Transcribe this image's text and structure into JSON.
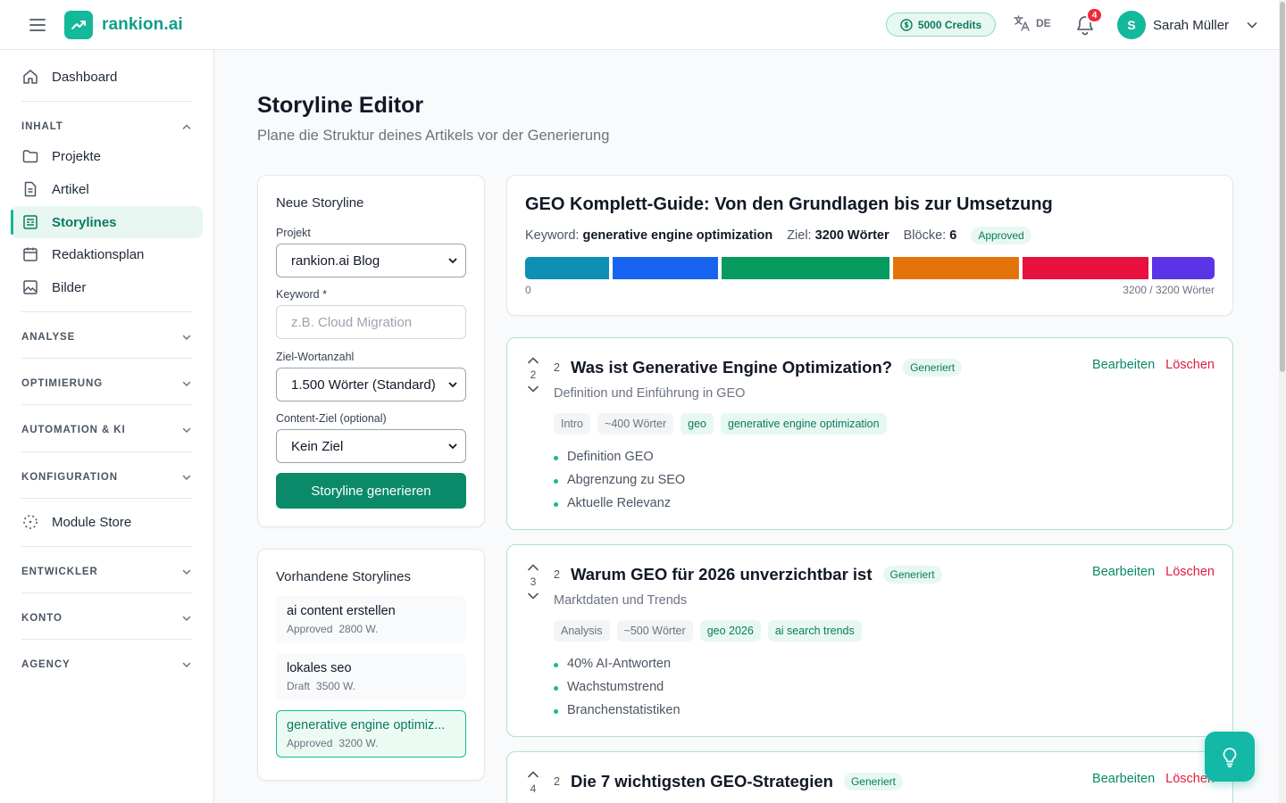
{
  "header": {
    "brand": "rankion.ai",
    "credits": "5000 Credits",
    "language": "DE",
    "notifications_count": "4",
    "user_initial": "S",
    "user_name": "Sarah Müller"
  },
  "sidebar": {
    "dashboard": "Dashboard",
    "sections": {
      "inhalt": "INHALT",
      "analyse": "ANALYSE",
      "optimierung": "OPTIMIERUNG",
      "automation": "AUTOMATION & KI",
      "konfiguration": "KONFIGURATION",
      "entwickler": "ENTWICKLER",
      "konto": "KONTO",
      "agency": "AGENCY"
    },
    "items": {
      "projekte": "Projekte",
      "artikel": "Artikel",
      "storylines": "Storylines",
      "redaktionsplan": "Redaktionsplan",
      "bilder": "Bilder",
      "module_store": "Module Store"
    }
  },
  "page": {
    "title": "Storyline Editor",
    "subtitle": "Plane die Struktur deines Artikels vor der Generierung"
  },
  "new_storyline": {
    "title": "Neue Storyline",
    "project_label": "Projekt",
    "project_value": "rankion.ai Blog",
    "keyword_label": "Keyword *",
    "keyword_placeholder": "z.B. Cloud Migration",
    "target_label": "Ziel-Wortanzahl",
    "target_value": "1.500 Wörter (Standard)",
    "goal_label": "Content-Ziel (optional)",
    "goal_value": "Kein Ziel",
    "button": "Storyline generieren"
  },
  "existing": {
    "title": "Vorhandene Storylines",
    "items": [
      {
        "name": "ai content erstellen",
        "status": "Approved",
        "words": "2800 W."
      },
      {
        "name": "lokales seo",
        "status": "Draft",
        "words": "3500 W."
      },
      {
        "name": "generative engine optimiz...",
        "status": "Approved",
        "words": "3200 W."
      }
    ]
  },
  "overview": {
    "title": "GEO Komplett-Guide: Von den Grundlagen bis zur Umsetzung",
    "keyword_label": "Keyword:",
    "keyword": "generative engine optimization",
    "target_label": "Ziel:",
    "target": "3200 Wörter",
    "blocks_label": "Blöcke:",
    "blocks": "6",
    "status": "Approved",
    "bar_start": "0",
    "bar_total": "3200 / 3200 Wörter",
    "segments": [
      {
        "words": 400,
        "color": "#0e8fb3"
      },
      {
        "words": 500,
        "color": "#1664f0"
      },
      {
        "words": 800,
        "color": "#069a5e"
      },
      {
        "words": 600,
        "color": "#e4740a"
      },
      {
        "words": 600,
        "color": "#e8103f"
      },
      {
        "words": 300,
        "color": "#5b34e8"
      }
    ]
  },
  "blocks": [
    {
      "order": "2",
      "index": "2",
      "title": "Was ist Generative Engine Optimization?",
      "status": "Generiert",
      "subtitle": "Definition und Einführung in GEO",
      "chips": [
        {
          "text": "Intro",
          "style": "gray"
        },
        {
          "text": "~400 Wörter",
          "style": "gray"
        },
        {
          "text": "geo",
          "style": "green"
        },
        {
          "text": "generative engine optimization",
          "style": "green"
        }
      ],
      "bullets": [
        "Definition GEO",
        "Abgrenzung zu SEO",
        "Aktuelle Relevanz"
      ]
    },
    {
      "order": "3",
      "index": "2",
      "title": "Warum GEO für 2026 unverzichtbar ist",
      "status": "Generiert",
      "subtitle": "Marktdaten und Trends",
      "chips": [
        {
          "text": "Analysis",
          "style": "gray"
        },
        {
          "text": "~500 Wörter",
          "style": "gray"
        },
        {
          "text": "geo 2026",
          "style": "green"
        },
        {
          "text": "ai search trends",
          "style": "green"
        }
      ],
      "bullets": [
        "40% AI-Antworten",
        "Wachstumstrend",
        "Branchenstatistiken"
      ]
    },
    {
      "order": "4",
      "index": "2",
      "title": "Die 7 wichtigsten GEO-Strategien",
      "status": "Generiert",
      "subtitle": "",
      "chips": [],
      "bullets": []
    }
  ],
  "actions": {
    "edit": "Bearbeiten",
    "delete": "Löschen"
  },
  "colors": {
    "brand": "#14b89a",
    "primary_button": "#0a8a69",
    "danger": "#e11d3b"
  },
  "icons": {
    "menu": "hamburger-icon",
    "logo": "trending-up-icon",
    "credits": "coin-icon",
    "language": "translate-icon",
    "notifications": "bell-icon",
    "fab": "lightbulb-icon"
  }
}
